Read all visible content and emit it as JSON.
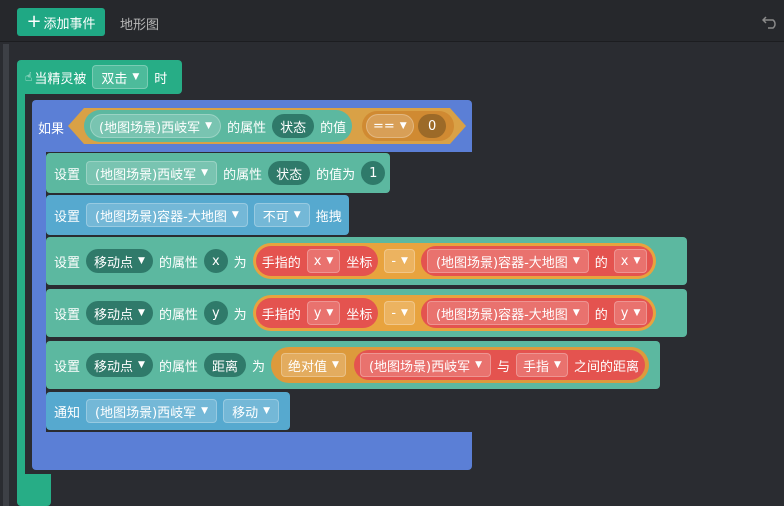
{
  "toolbar": {
    "add_event_label": "添加事件",
    "tab_label": "地形图"
  },
  "event": {
    "prefix": "当精灵被",
    "trigger": "双击",
    "suffix": "时"
  },
  "if_block": {
    "keyword": "如果",
    "object": "(地图场景)西岐军",
    "prop_text": "的属性",
    "prop": "状态",
    "value_text": "的值",
    "operator": "==",
    "value": "0"
  },
  "statements": [
    {
      "set": "设置",
      "object": "(地图场景)西岐军",
      "prop_text": "的属性",
      "prop": "状态",
      "value_text": "的值为",
      "value": "1"
    },
    {
      "set": "设置",
      "object": "(地图场景)容器-大地图",
      "mode": "不可",
      "action": "拖拽"
    },
    {
      "set": "设置",
      "object": "移动点",
      "prop_text": "的属性",
      "prop": "x",
      "as_text": "为",
      "finger_text": "手指的",
      "axis": "x",
      "coord_text": "坐标",
      "op": "-",
      "ref_object": "(地图场景)容器-大地图",
      "of_text": "的",
      "ref_axis": "x"
    },
    {
      "set": "设置",
      "object": "移动点",
      "prop_text": "的属性",
      "prop": "y",
      "as_text": "为",
      "finger_text": "手指的",
      "axis": "y",
      "coord_text": "坐标",
      "op": "-",
      "ref_object": "(地图场景)容器-大地图",
      "of_text": "的",
      "ref_axis": "y"
    },
    {
      "set": "设置",
      "object": "移动点",
      "prop_text": "的属性",
      "prop": "距离",
      "as_text": "为",
      "abs_label": "绝对值",
      "from_object": "(地图场景)西岐军",
      "and_text": "与",
      "finger": "手指",
      "dist_text": "之间的距离"
    },
    {
      "notify": "通知",
      "object": "(地图场景)西岐军",
      "message": "移动"
    }
  ],
  "colors": {
    "event": "#27ad86",
    "if": "#5b7fd6",
    "set": "#5cb8a0",
    "set2": "#56a9cf",
    "notify": "#56a9cf",
    "compare": "#d08a32",
    "math": "#e4534f",
    "abs": "#dd9a3c"
  }
}
